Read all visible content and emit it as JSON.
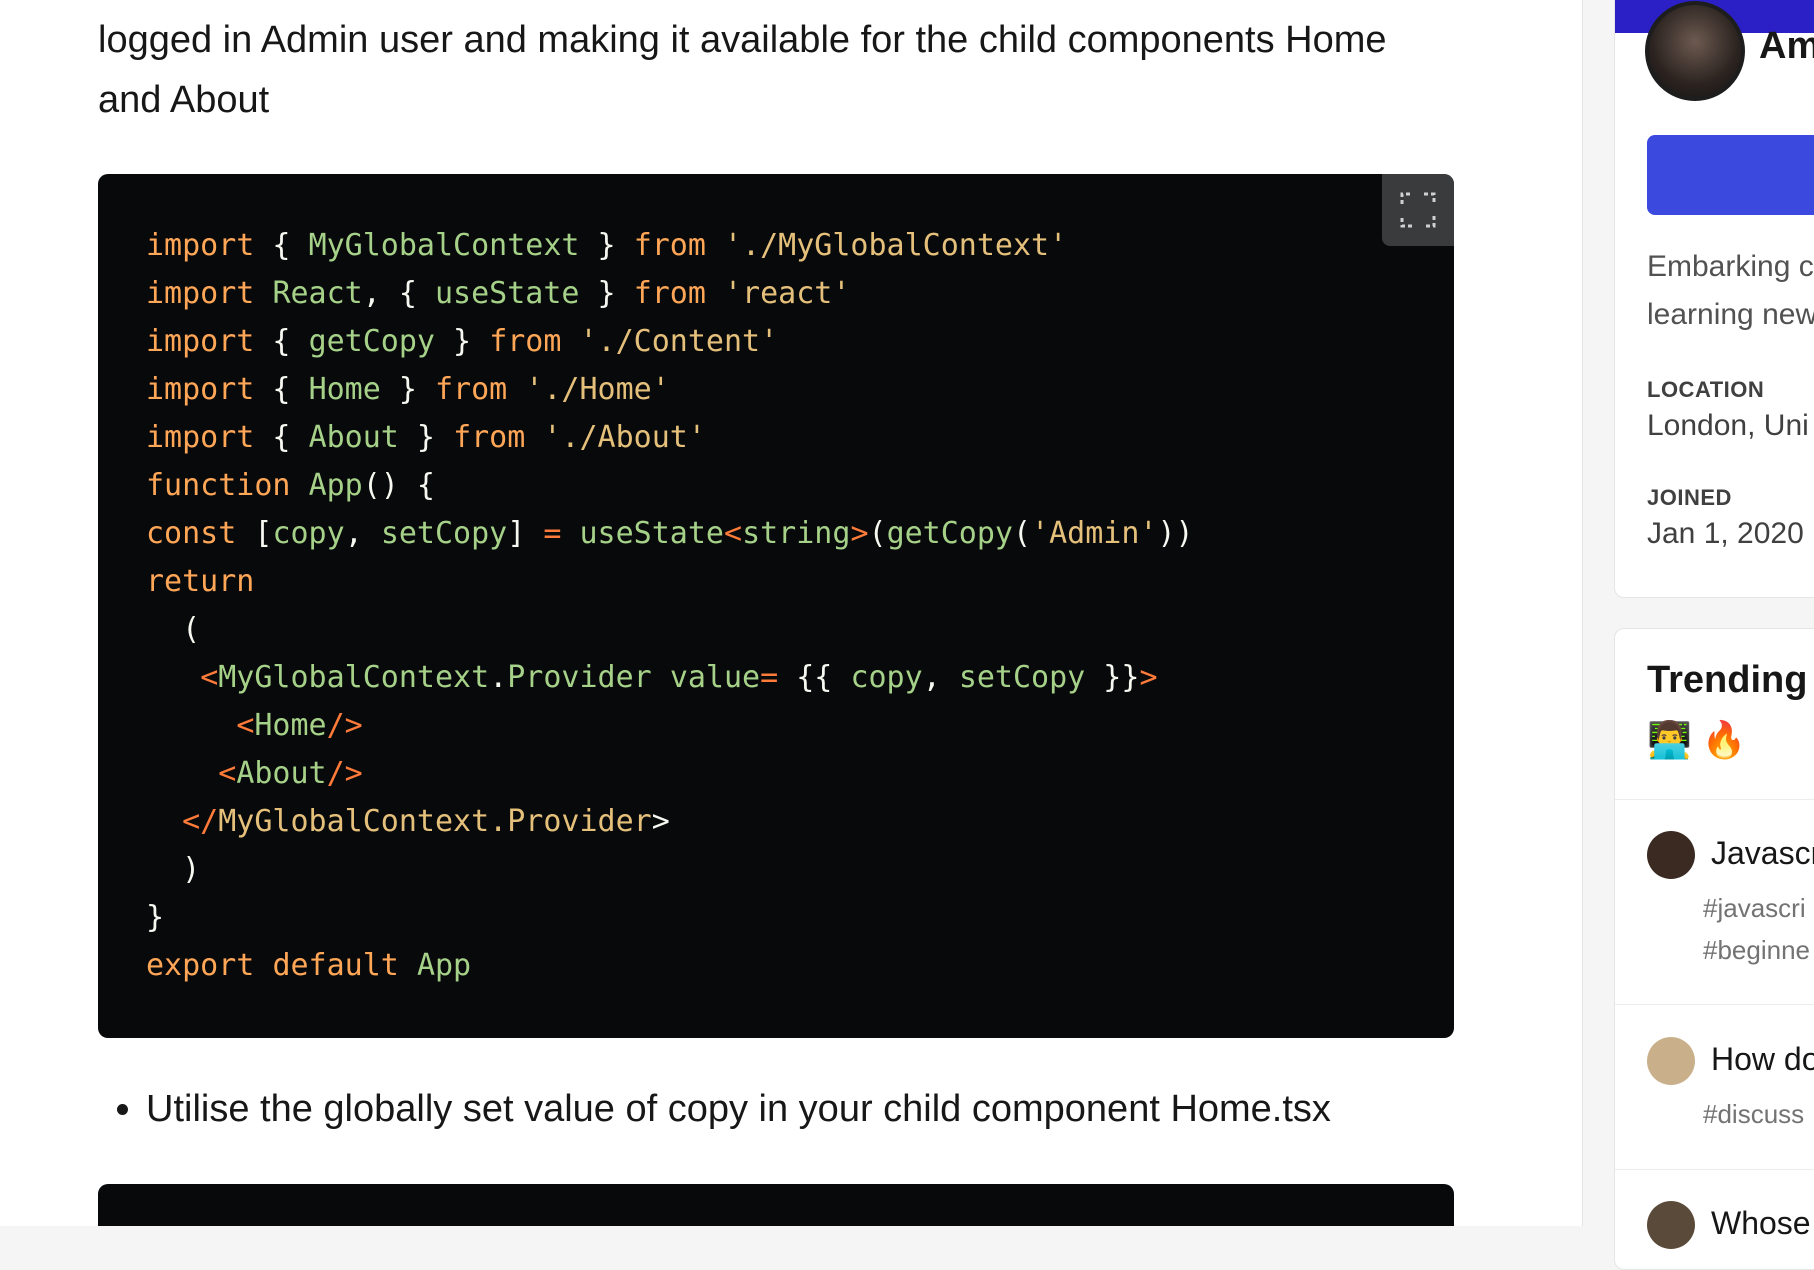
{
  "article": {
    "paragraph_line1": "logged in Admin user and making it available for the child components Home",
    "paragraph_line2": "and About",
    "bullet_text": "Utilise the globally set value of copy in your child component Home.tsx"
  },
  "code_lines": [
    [
      [
        "kw",
        "import"
      ],
      [
        "pun",
        " { "
      ],
      [
        "id",
        "MyGlobalContext"
      ],
      [
        "pun",
        " } "
      ],
      [
        "kw",
        "from"
      ],
      [
        "pun",
        " "
      ],
      [
        "str",
        "'./MyGlobalContext'"
      ]
    ],
    [
      [
        "kw",
        "import"
      ],
      [
        "pun",
        " "
      ],
      [
        "id",
        "React"
      ],
      [
        "pun",
        ", { "
      ],
      [
        "id",
        "useState"
      ],
      [
        "pun",
        " } "
      ],
      [
        "kw",
        "from"
      ],
      [
        "pun",
        " "
      ],
      [
        "str",
        "'react'"
      ]
    ],
    [
      [
        "kw",
        "import"
      ],
      [
        "pun",
        " { "
      ],
      [
        "id",
        "getCopy"
      ],
      [
        "pun",
        " } "
      ],
      [
        "kw",
        "from"
      ],
      [
        "pun",
        " "
      ],
      [
        "str",
        "'./Content'"
      ]
    ],
    [
      [
        "kw",
        "import"
      ],
      [
        "pun",
        " { "
      ],
      [
        "id",
        "Home"
      ],
      [
        "pun",
        " } "
      ],
      [
        "kw",
        "from"
      ],
      [
        "pun",
        " "
      ],
      [
        "str",
        "'./Home'"
      ]
    ],
    [
      [
        "kw",
        "import"
      ],
      [
        "pun",
        " { "
      ],
      [
        "id",
        "About"
      ],
      [
        "pun",
        " } "
      ],
      [
        "kw",
        "from"
      ],
      [
        "pun",
        " "
      ],
      [
        "str",
        "'./About'"
      ]
    ],
    [
      [
        "kw",
        "function"
      ],
      [
        "pun",
        " "
      ],
      [
        "id",
        "App"
      ],
      [
        "pun",
        "() {"
      ]
    ],
    [
      [
        "kw",
        "const"
      ],
      [
        "pun",
        " ["
      ],
      [
        "id",
        "copy"
      ],
      [
        "pun",
        ", "
      ],
      [
        "id",
        "setCopy"
      ],
      [
        "pun",
        "] "
      ],
      [
        "op",
        "="
      ],
      [
        "pun",
        " "
      ],
      [
        "id",
        "useState"
      ],
      [
        "tag",
        "<"
      ],
      [
        "id",
        "string"
      ],
      [
        "tag",
        ">"
      ],
      [
        "pun",
        "("
      ],
      [
        "id",
        "getCopy"
      ],
      [
        "pun",
        "("
      ],
      [
        "str",
        "'Admin'"
      ],
      [
        "pun",
        "))"
      ]
    ],
    [
      [
        "kw",
        "return"
      ]
    ],
    [
      [
        "pun",
        "  ("
      ]
    ],
    [
      [
        "pun",
        "   "
      ],
      [
        "tag",
        "<"
      ],
      [
        "id",
        "MyGlobalContext"
      ],
      [
        "pun",
        "."
      ],
      [
        "id",
        "Provider"
      ],
      [
        "pun",
        " "
      ],
      [
        "id",
        "value"
      ],
      [
        "op",
        "="
      ],
      [
        "pun",
        " {{ "
      ],
      [
        "id",
        "copy"
      ],
      [
        "pun",
        ", "
      ],
      [
        "id",
        "setCopy"
      ],
      [
        "pun",
        " }}"
      ],
      [
        "tag",
        ">"
      ]
    ],
    [
      [
        "pun",
        "     "
      ],
      [
        "tag",
        "<"
      ],
      [
        "id",
        "Home"
      ],
      [
        "tag",
        "/>"
      ]
    ],
    [
      [
        "pun",
        "    "
      ],
      [
        "tag",
        "<"
      ],
      [
        "id",
        "About"
      ],
      [
        "tag",
        "/>"
      ]
    ],
    [
      [
        "pun",
        "  "
      ],
      [
        "tag",
        "</"
      ],
      [
        "str",
        "MyGlobalContext.Provider"
      ],
      [
        "pun",
        ">"
      ]
    ],
    [
      [
        "pun",
        "  )"
      ]
    ],
    [
      [
        "pun",
        "}"
      ]
    ],
    [
      [
        "kw",
        "export"
      ],
      [
        "pun",
        " "
      ],
      [
        "kw",
        "default"
      ],
      [
        "pun",
        " "
      ],
      [
        "id",
        "App"
      ]
    ]
  ],
  "sidebar": {
    "profile": {
      "name": "Am",
      "bio_line1": "Embarking c",
      "bio_line2": "learning new",
      "location_label": "LOCATION",
      "location_value": "London, Uni",
      "joined_label": "JOINED",
      "joined_value": "Jan 1, 2020"
    },
    "trending": {
      "title": "Trending",
      "emojis": "👨‍💻 🔥",
      "items": [
        {
          "title": "Javascr",
          "tags": [
            "#javascri",
            "#beginne"
          ],
          "avatar_color": "#3a2a22"
        },
        {
          "title": "How do",
          "tags": [
            "#discuss"
          ],
          "avatar_color": "#c9b08a"
        },
        {
          "title": "Whose",
          "tags": [],
          "avatar_color": "#5a4a3a"
        }
      ]
    }
  },
  "colors": {
    "code_bg": "#08090a",
    "accent_blue": "#3b49df",
    "profile_banner": "#2b20c5"
  }
}
